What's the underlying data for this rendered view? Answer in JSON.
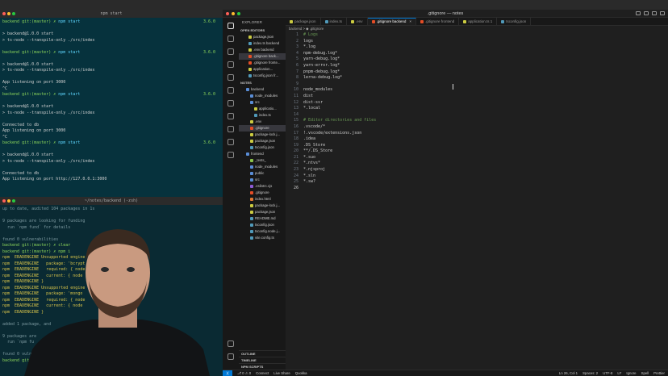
{
  "terminal1": {
    "title": "npm start",
    "lines": [
      {
        "prompt": "backend git:(master) ✗ ",
        "cmd": "npm start",
        "time": "3.6.0"
      },
      {
        "text": ""
      },
      {
        "text": "> backend@1.0.0 start"
      },
      {
        "text": "> ts-node --transpile-only ./src/index"
      },
      {
        "text": ""
      },
      {
        "prompt": "backend git:(master) ✗ ",
        "cmd": "npm start",
        "time": "3.6.0"
      },
      {
        "text": ""
      },
      {
        "text": "> backend@1.0.0 start"
      },
      {
        "text": "> ts-node --transpile-only ./src/index"
      },
      {
        "text": ""
      },
      {
        "text": "App listening on port 3000"
      },
      {
        "text": "^C"
      },
      {
        "prompt": "backend git:(master) ✗ ",
        "cmd": "npm start",
        "time": "3.6.0"
      },
      {
        "text": ""
      },
      {
        "text": "> backend@1.0.0 start"
      },
      {
        "text": "> ts-node --transpile-only ./src/index"
      },
      {
        "text": ""
      },
      {
        "text": "Connected to db"
      },
      {
        "text": "App listening on port 3000"
      },
      {
        "text": "^C"
      },
      {
        "prompt": "backend git:(master) ✗ ",
        "cmd": "npm start",
        "time": "3.6.0"
      },
      {
        "text": ""
      },
      {
        "text": "> backend@1.0.0 start"
      },
      {
        "text": "> ts-node --transpile-only ./src/index"
      },
      {
        "text": ""
      },
      {
        "text": "Connected to db"
      },
      {
        "text": "App listening on port http://127.0.0.1:3000"
      }
    ]
  },
  "terminal2": {
    "title": "~/notes/backend (-zsh)",
    "lines": [
      {
        "text": "up to date, audited 104 packages in 1s",
        "cls": "c-gray"
      },
      {
        "text": ""
      },
      {
        "text": "9 packages are looking for funding",
        "cls": "c-gray"
      },
      {
        "text": "  run `npm fund` for details",
        "cls": "c-gray"
      },
      {
        "text": ""
      },
      {
        "text": "found 0 vulnerabilities",
        "cls": "c-gray"
      },
      {
        "text": "backend git:(master) ✗ clear",
        "cls": "c-green"
      },
      {
        "text": "backend git:(master) ✗ npm i",
        "cls": "c-green"
      },
      {
        "text": "npm  EBADENGINE Unsupported engine",
        "cls": "c-yellow"
      },
      {
        "text": "npm  EBADENGINE   package: 'bcrypt",
        "cls": "c-yellow"
      },
      {
        "text": "npm  EBADENGINE   required: { node",
        "cls": "c-yellow"
      },
      {
        "text": "npm  EBADENGINE   current: { node",
        "cls": "c-yellow"
      },
      {
        "text": "npm  EBADENGINE }",
        "cls": "c-yellow"
      },
      {
        "text": "npm  EBADENGINE Unsupported engine",
        "cls": "c-yellow"
      },
      {
        "text": "npm  EBADENGINE   package: 'mongo",
        "cls": "c-yellow"
      },
      {
        "text": "npm  EBADENGINE   required: { node",
        "cls": "c-yellow"
      },
      {
        "text": "npm  EBADENGINE   current: { node",
        "cls": "c-yellow"
      },
      {
        "text": "npm  EBADENGINE }",
        "cls": "c-yellow"
      },
      {
        "text": ""
      },
      {
        "text": "added 1 package, and",
        "cls": "c-gray"
      },
      {
        "text": ""
      },
      {
        "text": "9 packages are",
        "cls": "c-gray"
      },
      {
        "text": "  run `npm fu",
        "cls": "c-gray"
      },
      {
        "text": ""
      },
      {
        "text": "found 0 vuln",
        "cls": "c-gray"
      },
      {
        "text": "backend git:",
        "cls": "c-green"
      }
    ]
  },
  "vscode": {
    "window_title": ".gitignore — notes",
    "explorer_label": "EXPLORER",
    "open_editors_label": "OPEN EDITORS",
    "open_editors": [
      {
        "name": "package.json",
        "color": "#cbcb41"
      },
      {
        "name": "index.ts backend",
        "color": "#519aba"
      },
      {
        "name": ".env backend",
        "color": "#cbcb41"
      },
      {
        "name": ".gitignore back...",
        "color": "#e44d26",
        "selected": true
      },
      {
        "name": ".gitignore fronte...",
        "color": "#e44d26"
      },
      {
        "name": "application...",
        "color": "#cbcb41"
      },
      {
        "name": "tsconfig.json fr...",
        "color": "#519aba"
      }
    ],
    "notes_label": "NOTES",
    "tree": [
      {
        "name": "backend",
        "color": "#5a8dd6",
        "indent": 1
      },
      {
        "name": "node_modules",
        "color": "#5a8dd6",
        "indent": 2
      },
      {
        "name": "src",
        "color": "#5a8dd6",
        "indent": 2
      },
      {
        "name": "applicatio...",
        "color": "#cbcb41",
        "indent": 3
      },
      {
        "name": "index.ts",
        "color": "#519aba",
        "indent": 3
      },
      {
        "name": ".env",
        "color": "#cbcb41",
        "indent": 2
      },
      {
        "name": ".gitignore",
        "color": "#e44d26",
        "indent": 2,
        "selected": true
      },
      {
        "name": "package-lock.j...",
        "color": "#cbcb41",
        "indent": 2
      },
      {
        "name": "package.json",
        "color": "#cbcb41",
        "indent": 2
      },
      {
        "name": "tsconfig.json",
        "color": "#519aba",
        "indent": 2
      },
      {
        "name": "frontend",
        "color": "#5a8dd6",
        "indent": 1
      },
      {
        "name": "_tests_",
        "color": "#8bc34a",
        "indent": 2
      },
      {
        "name": "node_modules",
        "color": "#5a8dd6",
        "indent": 2
      },
      {
        "name": "public",
        "color": "#5a8dd6",
        "indent": 2
      },
      {
        "name": "src",
        "color": "#5a8dd6",
        "indent": 2
      },
      {
        "name": ".eslintrc.cjs",
        "color": "#8e5bd6",
        "indent": 2
      },
      {
        "name": ".gitignore",
        "color": "#e44d26",
        "indent": 2
      },
      {
        "name": "index.html",
        "color": "#e37933",
        "indent": 2
      },
      {
        "name": "package-lock.j...",
        "color": "#cbcb41",
        "indent": 2
      },
      {
        "name": "package.json",
        "color": "#cbcb41",
        "indent": 2
      },
      {
        "name": "README.md",
        "color": "#519aba",
        "indent": 2
      },
      {
        "name": "tsconfig.json",
        "color": "#519aba",
        "indent": 2
      },
      {
        "name": "tsconfig.node.j...",
        "color": "#519aba",
        "indent": 2
      },
      {
        "name": "vite.config.ts",
        "color": "#519aba",
        "indent": 2
      }
    ],
    "bottom_sections": [
      "OUTLINE",
      "TIMELINE",
      "NPM SCRIPTS"
    ],
    "tabs": [
      {
        "label": "package.json",
        "color": "#cbcb41"
      },
      {
        "label": "index.ts",
        "color": "#519aba"
      },
      {
        "label": ".env",
        "color": "#cbcb41"
      },
      {
        "label": ".gitignore backend",
        "color": "#e44d26",
        "active": true
      },
      {
        "label": ".gitignore frontend",
        "color": "#e44d26"
      },
      {
        "label": "application.ts 1",
        "color": "#cbcb41"
      },
      {
        "label": "tsconfig.json",
        "color": "#519aba"
      }
    ],
    "breadcrumb": "backend > ◆ .gitignore",
    "code_lines": [
      {
        "n": "1",
        "t": "# Logs",
        "comment": true
      },
      {
        "n": "2",
        "t": "logs"
      },
      {
        "n": "3",
        "t": "*.log"
      },
      {
        "n": "4",
        "t": "npm-debug.log*"
      },
      {
        "n": "5",
        "t": "yarn-debug.log*"
      },
      {
        "n": "6",
        "t": "yarn-error.log*"
      },
      {
        "n": "7",
        "t": "pnpm-debug.log*"
      },
      {
        "n": "8",
        "t": "lerna-debug.log*"
      },
      {
        "n": "9",
        "t": ""
      },
      {
        "n": "10",
        "t": "node_modules"
      },
      {
        "n": "11",
        "t": "dist"
      },
      {
        "n": "12",
        "t": "dist-ssr"
      },
      {
        "n": "13",
        "t": "*.local"
      },
      {
        "n": "14",
        "t": ""
      },
      {
        "n": "15",
        "t": "# Editor directories and files",
        "comment": true
      },
      {
        "n": "16",
        "t": ".vscode/*"
      },
      {
        "n": "17",
        "t": "!.vscode/extensions.json"
      },
      {
        "n": "18",
        "t": ".idea"
      },
      {
        "n": "19",
        "t": ".DS_Store"
      },
      {
        "n": "20",
        "t": "**/.DS_Store"
      },
      {
        "n": "21",
        "t": "*.suo"
      },
      {
        "n": "22",
        "t": "*.ntvs*"
      },
      {
        "n": "23",
        "t": "*.njsproj"
      },
      {
        "n": "24",
        "t": "*.sln"
      },
      {
        "n": "25",
        "t": "*.sw?"
      },
      {
        "n": "26",
        "t": "",
        "current": true
      }
    ],
    "status": {
      "left": [
        "⎇ 0 ⚠ 0",
        "Connect",
        "Live Share",
        "Quokka"
      ],
      "right": [
        "Ln 26, Col 1",
        "Spaces: 2",
        "UTF-8",
        "LF",
        "Ignore",
        "Spell",
        "Prettier"
      ]
    }
  }
}
